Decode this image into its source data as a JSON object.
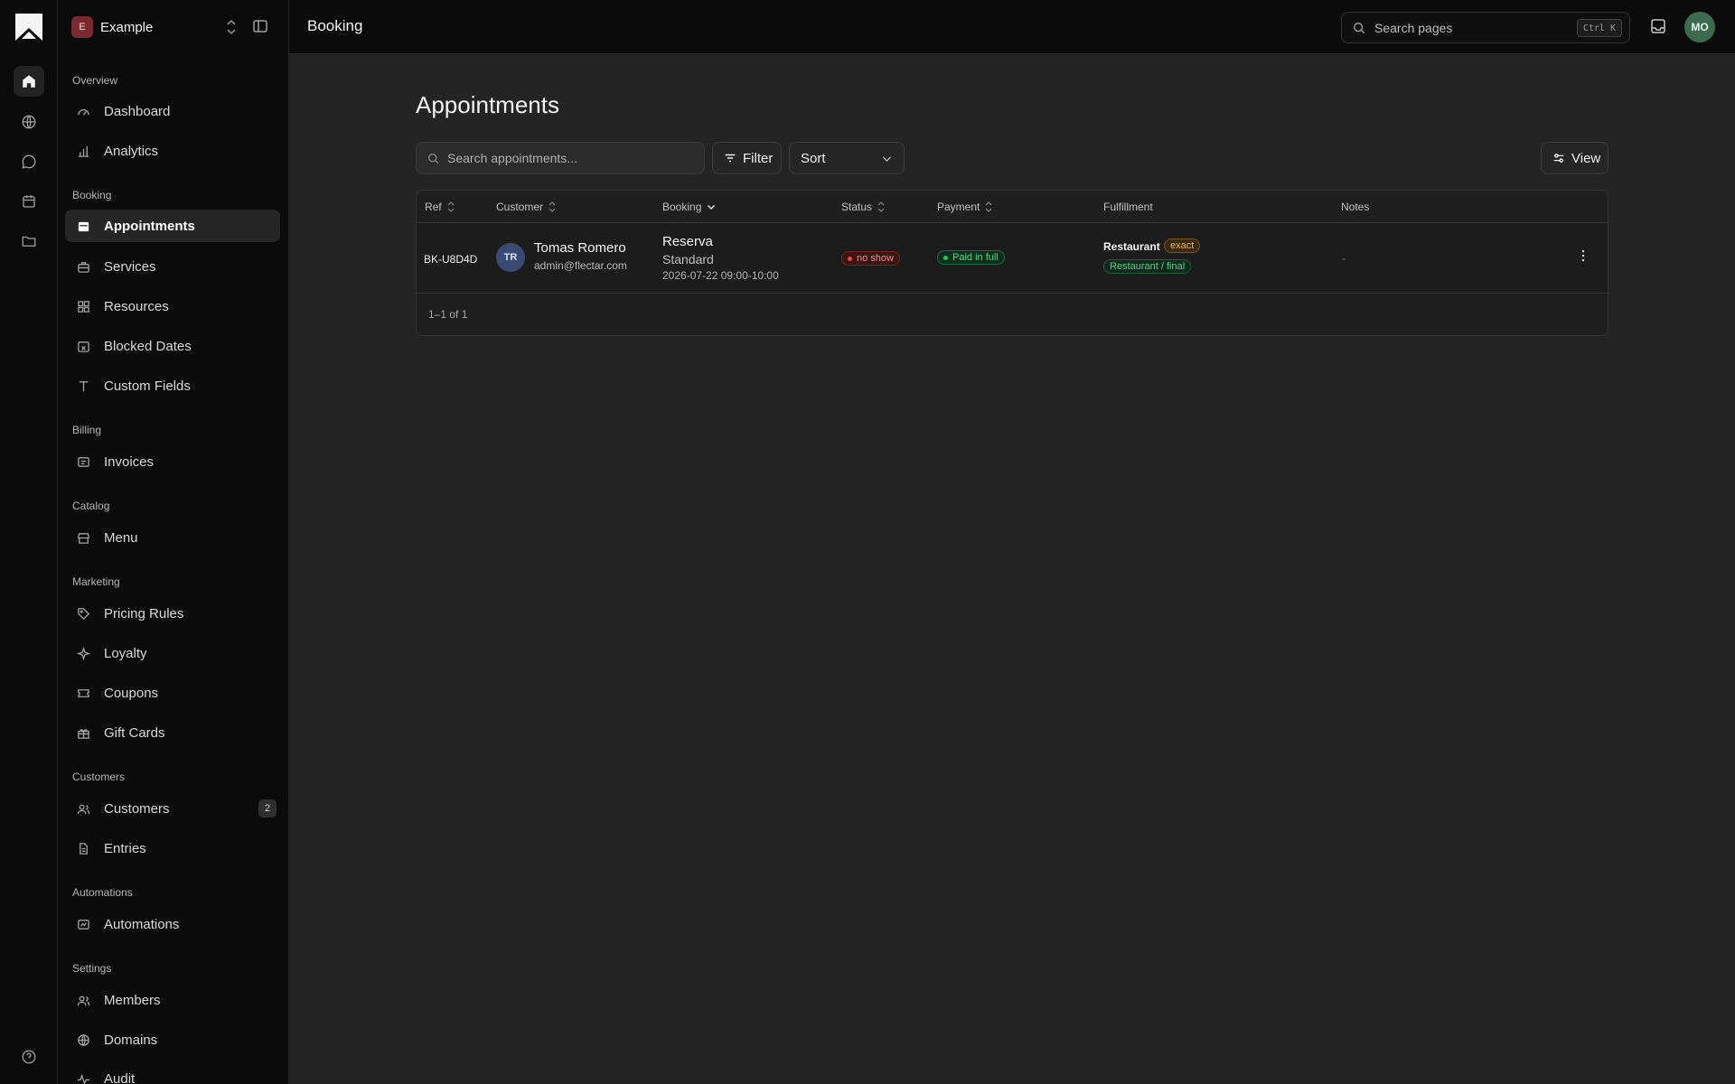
{
  "app": {
    "workspace_initial": "E",
    "workspace_name": "Example",
    "page_section_title": "Booking"
  },
  "colors": {
    "background": "#242424",
    "sidebar": "#0b0b0b",
    "workspace_badge": "#7a2a2e",
    "user_avatar": "#3d6b4f",
    "customer_avatar": "#3a4a73",
    "status_no_show": "#ef4444",
    "payment_paid": "#22c55e",
    "tag_exact": "#f0b541"
  },
  "rail": {
    "icons": [
      "home-icon",
      "globe-icon",
      "chat-icon",
      "calendar-icon",
      "folder-icon",
      "help-icon"
    ]
  },
  "topbar": {
    "search_placeholder": "Search pages",
    "shortcut": "Ctrl K",
    "user_initials": "MO"
  },
  "sidebar": {
    "groups": [
      {
        "label": "Overview",
        "items": [
          {
            "label": "Dashboard",
            "icon": "gauge-icon"
          },
          {
            "label": "Analytics",
            "icon": "bar-chart-icon"
          }
        ]
      },
      {
        "label": "Booking",
        "items": [
          {
            "label": "Appointments",
            "icon": "calendar-icon",
            "active": true
          },
          {
            "label": "Services",
            "icon": "briefcase-icon"
          },
          {
            "label": "Resources",
            "icon": "grid-icon"
          },
          {
            "label": "Blocked Dates",
            "icon": "calendar-x-icon"
          },
          {
            "label": "Custom Fields",
            "icon": "text-icon"
          }
        ]
      },
      {
        "label": "Billing",
        "items": [
          {
            "label": "Invoices",
            "icon": "receipt-icon"
          }
        ]
      },
      {
        "label": "Catalog",
        "items": [
          {
            "label": "Menu",
            "icon": "store-icon"
          }
        ]
      },
      {
        "label": "Marketing",
        "items": [
          {
            "label": "Pricing Rules",
            "icon": "tag-icon"
          },
          {
            "label": "Loyalty",
            "icon": "sparkle-icon"
          },
          {
            "label": "Coupons",
            "icon": "ticket-icon"
          },
          {
            "label": "Gift Cards",
            "icon": "gift-icon"
          }
        ]
      },
      {
        "label": "Customers",
        "items": [
          {
            "label": "Customers",
            "icon": "users-icon",
            "count": "2"
          },
          {
            "label": "Entries",
            "icon": "file-icon"
          }
        ]
      },
      {
        "label": "Automations",
        "items": [
          {
            "label": "Automations",
            "icon": "workflow-icon"
          }
        ]
      },
      {
        "label": "Settings",
        "items": [
          {
            "label": "Members",
            "icon": "users-icon"
          },
          {
            "label": "Domains",
            "icon": "globe-icon"
          },
          {
            "label": "Audit",
            "icon": "activity-icon"
          }
        ]
      }
    ]
  },
  "main": {
    "title": "Appointments",
    "search_placeholder": "Search appointments...",
    "filter_label": "Filter",
    "sort_label": "Sort",
    "view_label": "View",
    "columns": [
      "Ref",
      "Customer",
      "Booking",
      "Status",
      "Payment",
      "Fulfillment",
      "Notes"
    ],
    "rows": [
      {
        "ref": "BK-U8D4D",
        "customer_initials": "TR",
        "customer_name": "Tomas Romero",
        "customer_email": "admin@flectar.com",
        "booking_title": "Reserva",
        "booking_type": "Standard",
        "booking_time": "2026-07-22 09:00-10:00",
        "status": "no show",
        "payment": "Paid in full",
        "fulfillment_name": "Restaurant",
        "fulfillment_tag": "exact",
        "fulfillment_path": "Restaurant / final",
        "notes": "-"
      }
    ],
    "pagination": "1–1 of 1"
  }
}
